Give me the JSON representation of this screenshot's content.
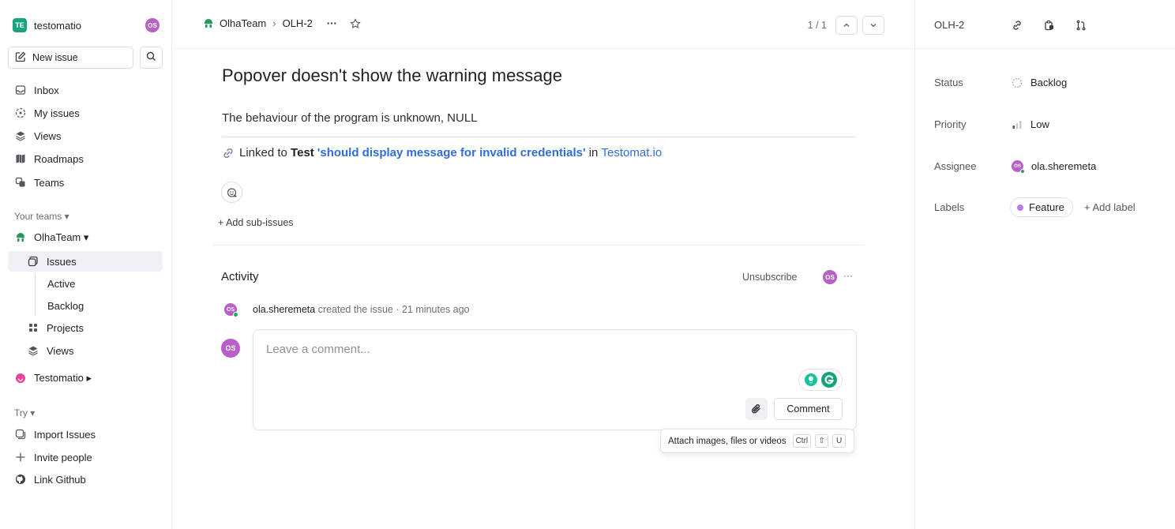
{
  "sidebar": {
    "workspace_badge": "TE",
    "workspace_name": "testomatio",
    "user_initials": "OS",
    "new_issue_label": "New issue",
    "nav": [
      {
        "label": "Inbox"
      },
      {
        "label": "My issues"
      },
      {
        "label": "Views"
      },
      {
        "label": "Roadmaps"
      },
      {
        "label": "Teams"
      }
    ],
    "your_teams_label": "Your teams ▾",
    "team_name": "OlhaTeam ▾",
    "team_items": [
      {
        "label": "Issues"
      },
      {
        "label": "Active"
      },
      {
        "label": "Backlog"
      },
      {
        "label": "Projects"
      },
      {
        "label": "Views"
      }
    ],
    "other_team": "Testomatio ▸",
    "try_label": "Try ▾",
    "try_items": [
      {
        "label": "Import Issues"
      },
      {
        "label": "Invite people"
      },
      {
        "label": "Link Github"
      }
    ]
  },
  "header": {
    "team": "OlhaTeam",
    "separator": "›",
    "issue_id": "OLH-2",
    "more": "···",
    "pager": "1 / 1"
  },
  "issue": {
    "title": "Popover doesn't show the warning message",
    "description": "The behaviour of the program is unknown, NULL",
    "linked_prefix": "Linked to ",
    "linked_test": "Test",
    "linked_name": "'should display message for invalid credentials'",
    "linked_in": " in ",
    "linked_target": "Testomat.io",
    "add_sub_issues": "+ Add sub-issues"
  },
  "activity": {
    "heading": "Activity",
    "unsubscribe": "Unsubscribe",
    "user_initials": "OS",
    "more": "···",
    "event_user": "ola.sheremeta",
    "event_text": " created the issue · ",
    "event_time": "21 minutes ago",
    "comment_placeholder": "Leave a comment...",
    "comment_button": "Comment",
    "tooltip_text": "Attach images, files or videos",
    "tooltip_keys": [
      "Ctrl",
      "⇧",
      "U"
    ]
  },
  "panel": {
    "issue_id": "OLH-2",
    "status_label": "Status",
    "status_value": "Backlog",
    "priority_label": "Priority",
    "priority_value": "Low",
    "assignee_label": "Assignee",
    "assignee_value": "ola.sheremeta",
    "labels_label": "Labels",
    "label_value": "Feature",
    "add_label": "+ Add label"
  },
  "colors": {
    "accent_link": "#2f6ed6",
    "avatar": "#b85fc9",
    "workspace_badge": "#1aa37f",
    "team_icon": "#1e9e54",
    "feature_dot": "#b97ee6"
  }
}
